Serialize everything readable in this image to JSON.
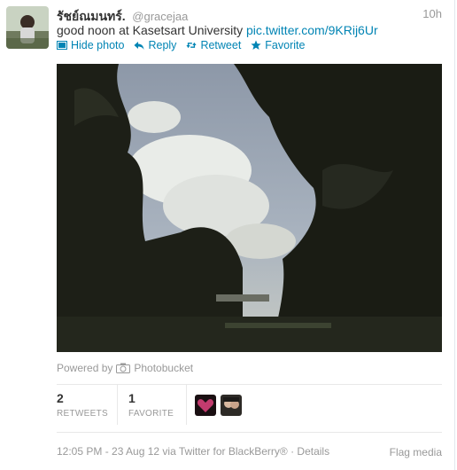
{
  "tweet": {
    "fullname": "รัชย์ณมนทร์.",
    "username": "@gracejaa",
    "time": "10h",
    "text": "good noon at Kasetsart University ",
    "link": "pic.twitter.com/9KRij6Ur",
    "actions": {
      "hide_photo": "Hide photo",
      "reply": "Reply",
      "retweet": "Retweet",
      "favorite": "Favorite"
    },
    "powered_by": "Powered by",
    "provider": "Photobucket",
    "stats": {
      "retweets_count": "2",
      "retweets_label": "RETWEETS",
      "favorites_count": "1",
      "favorites_label": "FAVORITE"
    },
    "footer": "12:05 PM - 23 Aug 12 via Twitter for BlackBerry® · Details",
    "flag": "Flag media"
  },
  "colors": {
    "link": "#0084b4",
    "muted": "#999999"
  },
  "icons": [
    "photo-icon",
    "reply-icon",
    "retweet-icon",
    "star-icon",
    "camera-icon"
  ]
}
